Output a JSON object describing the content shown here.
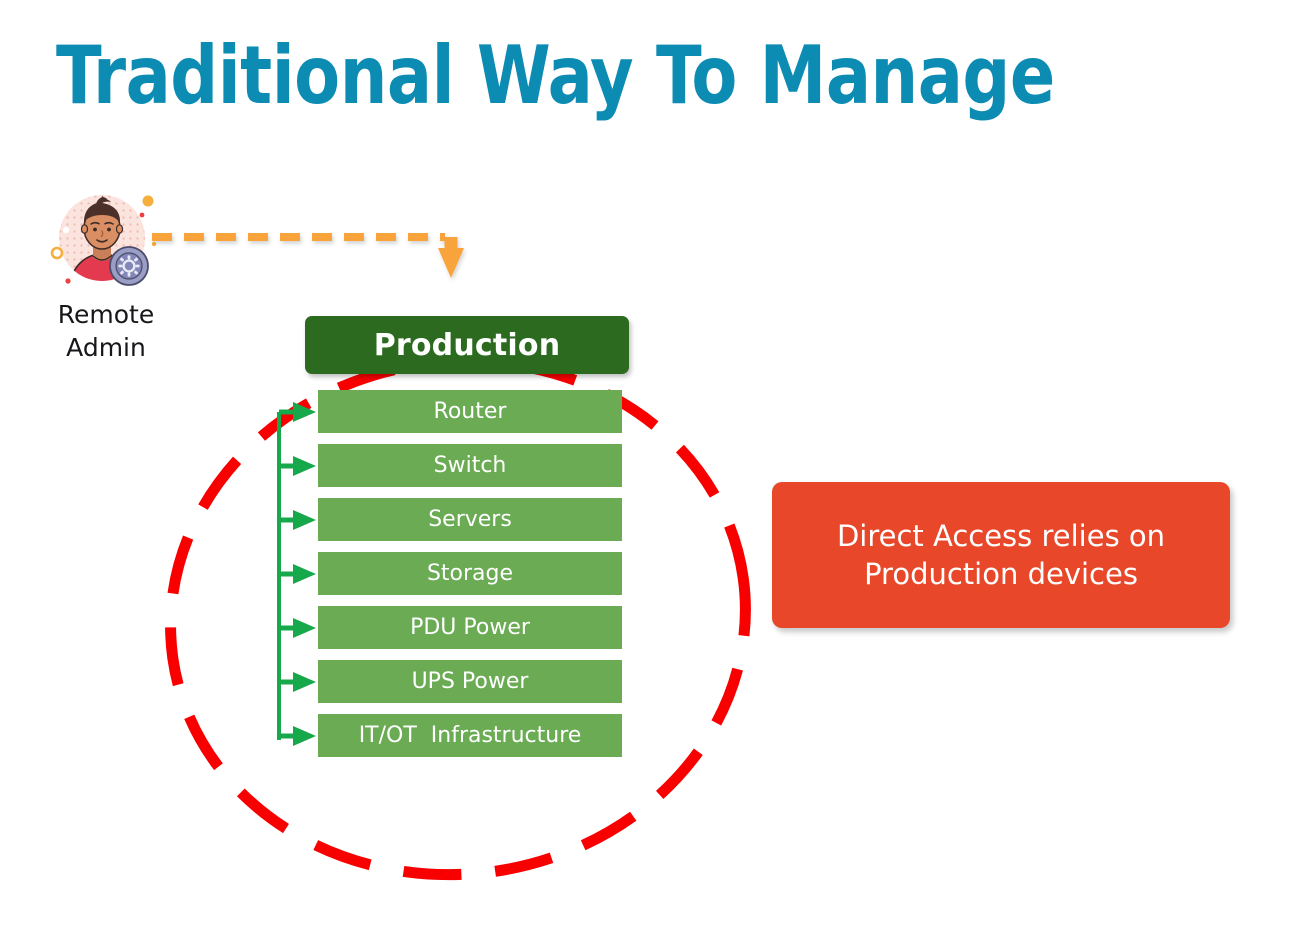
{
  "page": {
    "title": "Traditional Way To Manage",
    "background_color": "#ffffff"
  },
  "colors": {
    "title_teal": "#0d8cb3",
    "production_dark_green": "#2c6b1f",
    "device_green": "#6aab54",
    "connector_green": "#18a84c",
    "callout_red": "#e8472a",
    "circle_red": "#f80000",
    "dash_arrow_orange": "#f9a33c",
    "label_text": "#17171b"
  },
  "admin": {
    "icon": "remote-admin-avatar-icon",
    "label_line1": "Remote",
    "label_line2": "Admin"
  },
  "flow": {
    "admin_to_production_arrow": "dashed-orange-arrow"
  },
  "production": {
    "header_label": "Production",
    "devices": [
      {
        "label": "Router"
      },
      {
        "label": "Switch"
      },
      {
        "label": "Servers"
      },
      {
        "label": "Storage"
      },
      {
        "label": "PDU Power"
      },
      {
        "label": "UPS Power"
      },
      {
        "label": "IT/OT  Infrastructure"
      }
    ]
  },
  "callout": {
    "line1": "Direct Access relies on",
    "line2": "Production devices"
  }
}
